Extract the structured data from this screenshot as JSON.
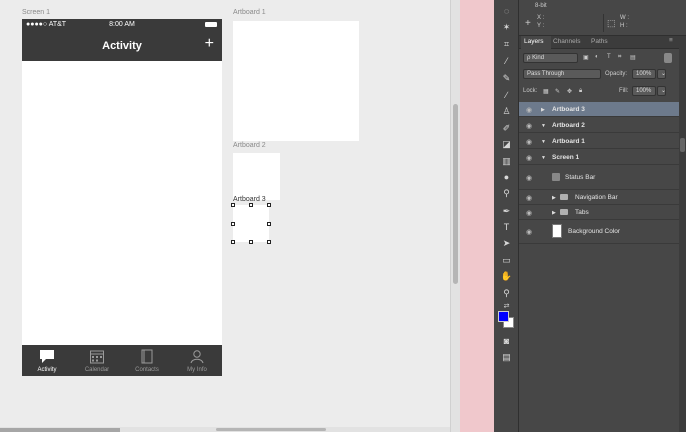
{
  "canvas": {
    "screen1_title": "Screen 1",
    "artboard1_title": "Artboard 1",
    "artboard2_title": "Artboard 2",
    "artboard3_title": "Artboard 3"
  },
  "phone": {
    "carrier": "●●●●○ AT&T",
    "time": "8:00 AM",
    "nav_title": "Activity",
    "plus": "+",
    "tabs": [
      {
        "label": "Activity",
        "icon": "chat-bubble-icon",
        "active": true
      },
      {
        "label": "Calendar",
        "icon": "calendar-icon",
        "active": false
      },
      {
        "label": "Contacts",
        "icon": "contacts-book-icon",
        "active": false
      },
      {
        "label": "My Info",
        "icon": "person-icon",
        "active": false
      }
    ]
  },
  "info_panel": {
    "title": "8-bit",
    "xy": "X :\nY :",
    "x_label": "X :",
    "y_label": "Y :",
    "w_label": "W :",
    "h_label": "H :"
  },
  "layers_panel": {
    "tabs": [
      "Layers",
      "Channels",
      "Paths"
    ],
    "kind": "ρ Kind",
    "blend_mode": "Pass Through",
    "opacity_label": "Opacity:",
    "opacity_value": "100%",
    "lock_label": "Lock:",
    "fill_label": "Fill:",
    "fill_value": "100%",
    "layers": [
      {
        "name": "Artboard 3",
        "type": "artboard",
        "selected": true
      },
      {
        "name": "Artboard 2",
        "type": "artboard",
        "selected": false
      },
      {
        "name": "Artboard 1",
        "type": "artboard",
        "selected": false
      },
      {
        "name": "Screen 1",
        "type": "artboard",
        "selected": false
      },
      {
        "name": "Status Bar",
        "type": "smart-object",
        "selected": false
      },
      {
        "name": "Navigation Bar",
        "type": "group",
        "selected": false
      },
      {
        "name": "Tabs",
        "type": "group",
        "selected": false
      },
      {
        "name": "Background Color",
        "type": "shape",
        "selected": false
      }
    ]
  },
  "colors": {
    "foreground": "#0000ff",
    "background": "#ffffff",
    "selected_layer": "#6d7a8c"
  }
}
